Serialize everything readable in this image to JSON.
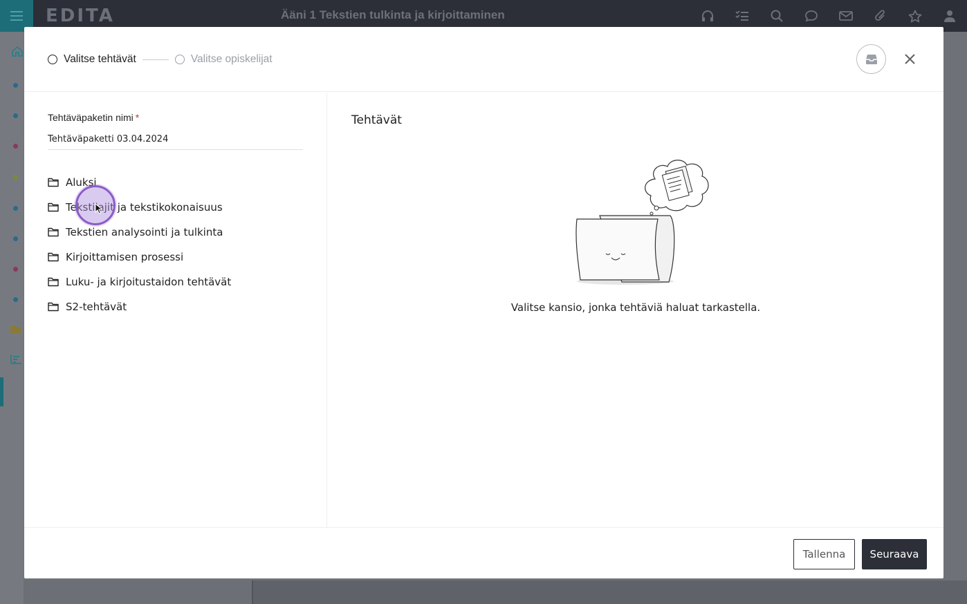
{
  "app": {
    "logo": "EDITA",
    "title": "Ääni 1 Tekstien tulkinta ja kirjoittaminen",
    "top_icons": [
      "headphones-icon",
      "checklist-icon",
      "search-icon",
      "chat-icon",
      "mail-icon",
      "paperclip-icon",
      "star-icon",
      "user-icon"
    ]
  },
  "modal": {
    "steps": [
      {
        "label": "Valitse tehtävät",
        "active": true
      },
      {
        "label": "Valitse opiskelijat",
        "active": false
      }
    ],
    "left": {
      "field_label": "Tehtäväpaketin nimi",
      "required_mark": "*",
      "field_value": "Tehtäväpaketti 03.04.2024",
      "folders": [
        "Aluksi",
        "Tekstilajit ja tekstikokonaisuus",
        "Tekstien analysointi ja tulkinta",
        "Kirjoittamisen prosessi",
        "Luku- ja kirjoitustaidon tehtävät",
        "S2-tehtävät"
      ]
    },
    "right": {
      "title": "Tehtävät",
      "empty_message": "Valitse kansio, jonka tehtäviä haluat tarkastella."
    },
    "footer": {
      "save_label": "Tallenna",
      "next_label": "Seuraava"
    }
  },
  "colors": {
    "topbar": "#2c2f37",
    "accent": "#1d6d78",
    "primary_button": "#2c2f37",
    "required": "#d0312d"
  }
}
